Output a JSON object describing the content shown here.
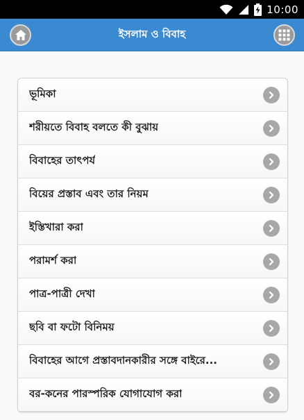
{
  "status_bar": {
    "time": "10:00",
    "icons": [
      "wifi-icon",
      "signal-icon",
      "battery-charging-icon"
    ]
  },
  "app_bar": {
    "title": "ইসলাম ও বিবাহ",
    "left_icon": "home-icon",
    "right_icon": "grid-menu-icon",
    "color": "#3b8ad1"
  },
  "menu_items": [
    {
      "label": "ভূমিকা"
    },
    {
      "label": "শরীয়তে বিবাহ বলতে কী বুঝায়"
    },
    {
      "label": "বিবাহের তাৎপর্য"
    },
    {
      "label": "বিয়ের প্রস্তাব এবং তার নিয়ম"
    },
    {
      "label": "ইস্তিখারা করা"
    },
    {
      "label": "পরামর্শ করা"
    },
    {
      "label": "পাত্র-পাত্রী দেখা"
    },
    {
      "label": "ছবি বা ফটো বিনিময়"
    },
    {
      "label": "বিবাহের আগে প্রস্তাবদানকারীর সঙ্গে বাইরে..."
    },
    {
      "label": "বর-কনের পারস্পরিক যোগাযোগ করা"
    }
  ]
}
